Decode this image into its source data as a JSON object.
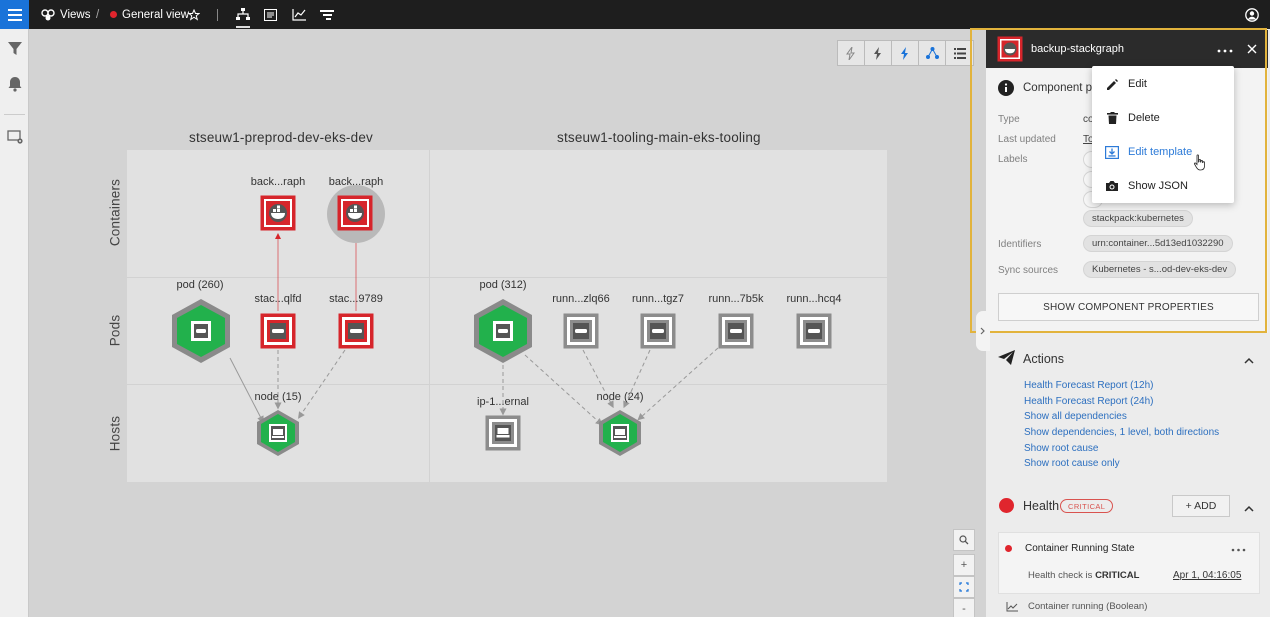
{
  "topbar": {
    "views_label": "Views",
    "separator": "/",
    "current_view": "General view",
    "status_color": "#e0252d",
    "icons": [
      "views-icon",
      "star-icon",
      "topology-view-icon",
      "events-view-icon",
      "metrics-view-icon",
      "traces-view-icon",
      "user-account-icon"
    ]
  },
  "leftnav": {
    "icons": [
      "filter-icon",
      "bell-icon",
      "settings-monitor-icon"
    ]
  },
  "canvas_toolbar": {
    "icons": [
      "lightning-off-icon",
      "lightning-partial-icon",
      "lightning-on-icon",
      "topology-icon",
      "list-icon"
    ]
  },
  "topology": {
    "layers": [
      "Containers",
      "Pods",
      "Hosts"
    ],
    "groups": [
      "stseuw1-preprod-dev-eks-dev",
      "stseuw1-tooling-main-eks-tooling"
    ],
    "containers": [
      {
        "label": "back...raph",
        "state": "critical"
      },
      {
        "label": "back...raph",
        "state": "critical",
        "selected": true
      }
    ],
    "pods": [
      {
        "label": "pod (260)",
        "state": "ok",
        "kind": "group"
      },
      {
        "label": "stac...qlfd",
        "state": "critical"
      },
      {
        "label": "stac...9789",
        "state": "critical"
      },
      {
        "label": "pod (312)",
        "state": "ok",
        "kind": "group"
      },
      {
        "label": "runn...zlq66",
        "state": "unknown"
      },
      {
        "label": "runn...tgz7",
        "state": "unknown"
      },
      {
        "label": "runn...7b5k",
        "state": "unknown"
      },
      {
        "label": "runn...hcq4",
        "state": "unknown"
      }
    ],
    "hosts": [
      {
        "label": "node (15)",
        "state": "ok",
        "kind": "group"
      },
      {
        "label": "ip-1...ernal",
        "state": "unknown"
      },
      {
        "label": "node (24)",
        "state": "ok",
        "kind": "group"
      }
    ],
    "state_colors": {
      "critical": "#d6252b",
      "ok": "#22b14c",
      "unknown": "#8c8c8c"
    }
  },
  "zoom_controls": [
    "zoom-search-icon",
    "+",
    "fit-icon",
    "-"
  ],
  "panel": {
    "component_name": "backup-stackgraph",
    "more_icon": "more-horizontal-icon",
    "close_icon": "close-icon",
    "section_title": "Component p",
    "properties": {
      "type_label": "Type",
      "type_value": "co",
      "last_updated_label": "Last updated",
      "last_updated_value": "To",
      "labels_label": "Labels",
      "labels": [
        "stackpack:kubernetes"
      ],
      "identifiers_label": "Identifiers",
      "identifiers": [
        "urn:container...5d13ed1032290"
      ],
      "sync_sources_label": "Sync sources",
      "sync_sources": [
        "Kubernetes - s...od-dev-eks-dev"
      ]
    },
    "show_properties_button": "SHOW COMPONENT PROPERTIES"
  },
  "menu": {
    "items": [
      {
        "label": "Edit",
        "icon": "pencil-icon"
      },
      {
        "label": "Delete",
        "icon": "trash-icon"
      },
      {
        "label": "Edit template",
        "icon": "download-template-icon",
        "active": true
      },
      {
        "label": "Show JSON",
        "icon": "camera-icon"
      }
    ]
  },
  "actions": {
    "title": "Actions",
    "links": [
      "Health Forecast Report (12h)",
      "Health Forecast Report (24h)",
      "Show all dependencies",
      "Show dependencies, 1 level, both directions",
      "Show root cause",
      "Show root cause only"
    ]
  },
  "health": {
    "title": "Health",
    "badge": "CRITICAL",
    "add_button": "+ ADD",
    "check_name": "Container Running State",
    "check_text_prefix": "Health check is",
    "check_state": "CRITICAL",
    "check_time": "Apr 1, 04:16:05",
    "metric_name": "Container running (Boolean)"
  }
}
